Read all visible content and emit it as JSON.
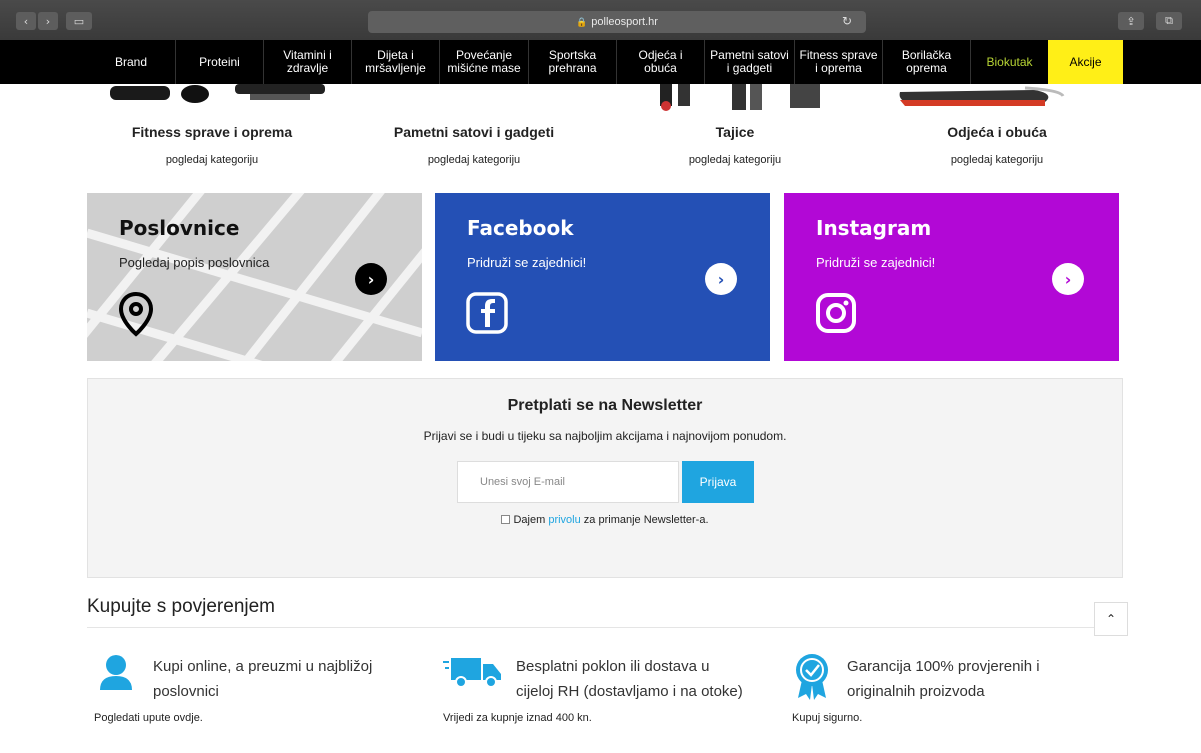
{
  "browser": {
    "url": "polleosport.hr",
    "back_icon": "chevron-left-icon",
    "forward_icon": "chevron-right-icon"
  },
  "nav": {
    "items": [
      "Brand",
      "Proteini",
      "Vitamini i\nzdravlje",
      "Dijeta i\nmršavljenje",
      "Povećanje\nmišićne mase",
      "Sportska\nprehrana",
      "Odjeća i\nobuća",
      "Pametni satovi\ni gadgeti",
      "Fitness sprave\ni oprema",
      "Borilačka\noprema",
      "Biokutak",
      "Akcije"
    ]
  },
  "categories": [
    {
      "title": "Fitness sprave i oprema",
      "link": "pogledaj kategoriju"
    },
    {
      "title": "Pametni satovi i gadgeti",
      "link": "pogledaj kategoriju"
    },
    {
      "title": "Tajice",
      "link": "pogledaj kategoriju"
    },
    {
      "title": "Odjeća i obuća",
      "link": "pogledaj kategoriju"
    }
  ],
  "cards": {
    "stores": {
      "title": "Poslovnice",
      "subtitle": "Pogledaj popis poslovnica",
      "bg": "#cfcfcf"
    },
    "facebook": {
      "title": "Facebook",
      "subtitle": "Pridruži se zajednici!",
      "bg": "#2450b5"
    },
    "instagram": {
      "title": "Instagram",
      "subtitle": "Pridruži se zajednici!",
      "bg": "#b208d6"
    }
  },
  "newsletter": {
    "title": "Pretplati se na Newsletter",
    "subtitle": "Prijavi se i budi u tijeku sa najboljim akcijama i najnovijom ponudom.",
    "placeholder": "Unesi svoj E-mail",
    "button": "Prijava",
    "consent_pre": "Dajem",
    "consent_link": "privolu",
    "consent_post": "za primanje Newsletter-a."
  },
  "trust": {
    "title": "Kupujte s povjerenjem",
    "items": [
      {
        "line1": "Kupi online, a preuzmi u najbližoj",
        "line2": "poslovnici",
        "foot": "Pogledati upute ovdje."
      },
      {
        "line1": "Besplatni poklon ili dostava u",
        "line2": "cijeloj RH (dostavljamo i na otoke)",
        "foot": "Vrijedi za kupnje iznad 400 kn."
      },
      {
        "line1": "Garancija 100% provjerenih i",
        "line2": "originalnih proizvoda",
        "foot": "Kupuj sigurno."
      }
    ]
  },
  "colors": {
    "accent": "#1fa5e0",
    "promo": "#ffef17",
    "organic": "#b6d334"
  }
}
